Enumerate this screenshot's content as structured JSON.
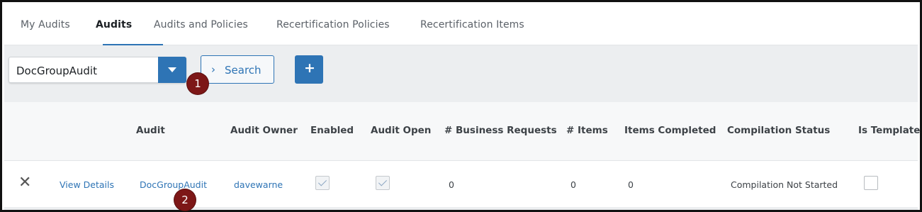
{
  "tabs": [
    {
      "label": "My Audits"
    },
    {
      "label": "Audits"
    },
    {
      "label": "Audits and Policies"
    },
    {
      "label": "Recertification Policies"
    },
    {
      "label": "Recertification Items"
    }
  ],
  "active_tab": "Audits",
  "toolbar": {
    "dropdown_value": "DocGroupAudit",
    "search_label": "Search",
    "add_label": "+"
  },
  "table": {
    "columns": [
      "Audit",
      "Audit Owner",
      "Enabled",
      "Audit Open",
      "# Business Requests",
      "# Items",
      "Items Completed",
      "Compilation Status",
      "Is Template"
    ],
    "rows": [
      {
        "action_remove": "✕",
        "action_view": "View Details",
        "audit": "DocGroupAudit",
        "owner": "davewarne",
        "enabled": true,
        "open": true,
        "business_requests": "0",
        "items": "0",
        "items_completed": "0",
        "compilation_status": "Compilation Not Started",
        "is_template": false
      }
    ]
  },
  "markers": [
    "1",
    "2"
  ],
  "colors": {
    "accent": "#2e74b5",
    "marker": "#7d1717"
  }
}
